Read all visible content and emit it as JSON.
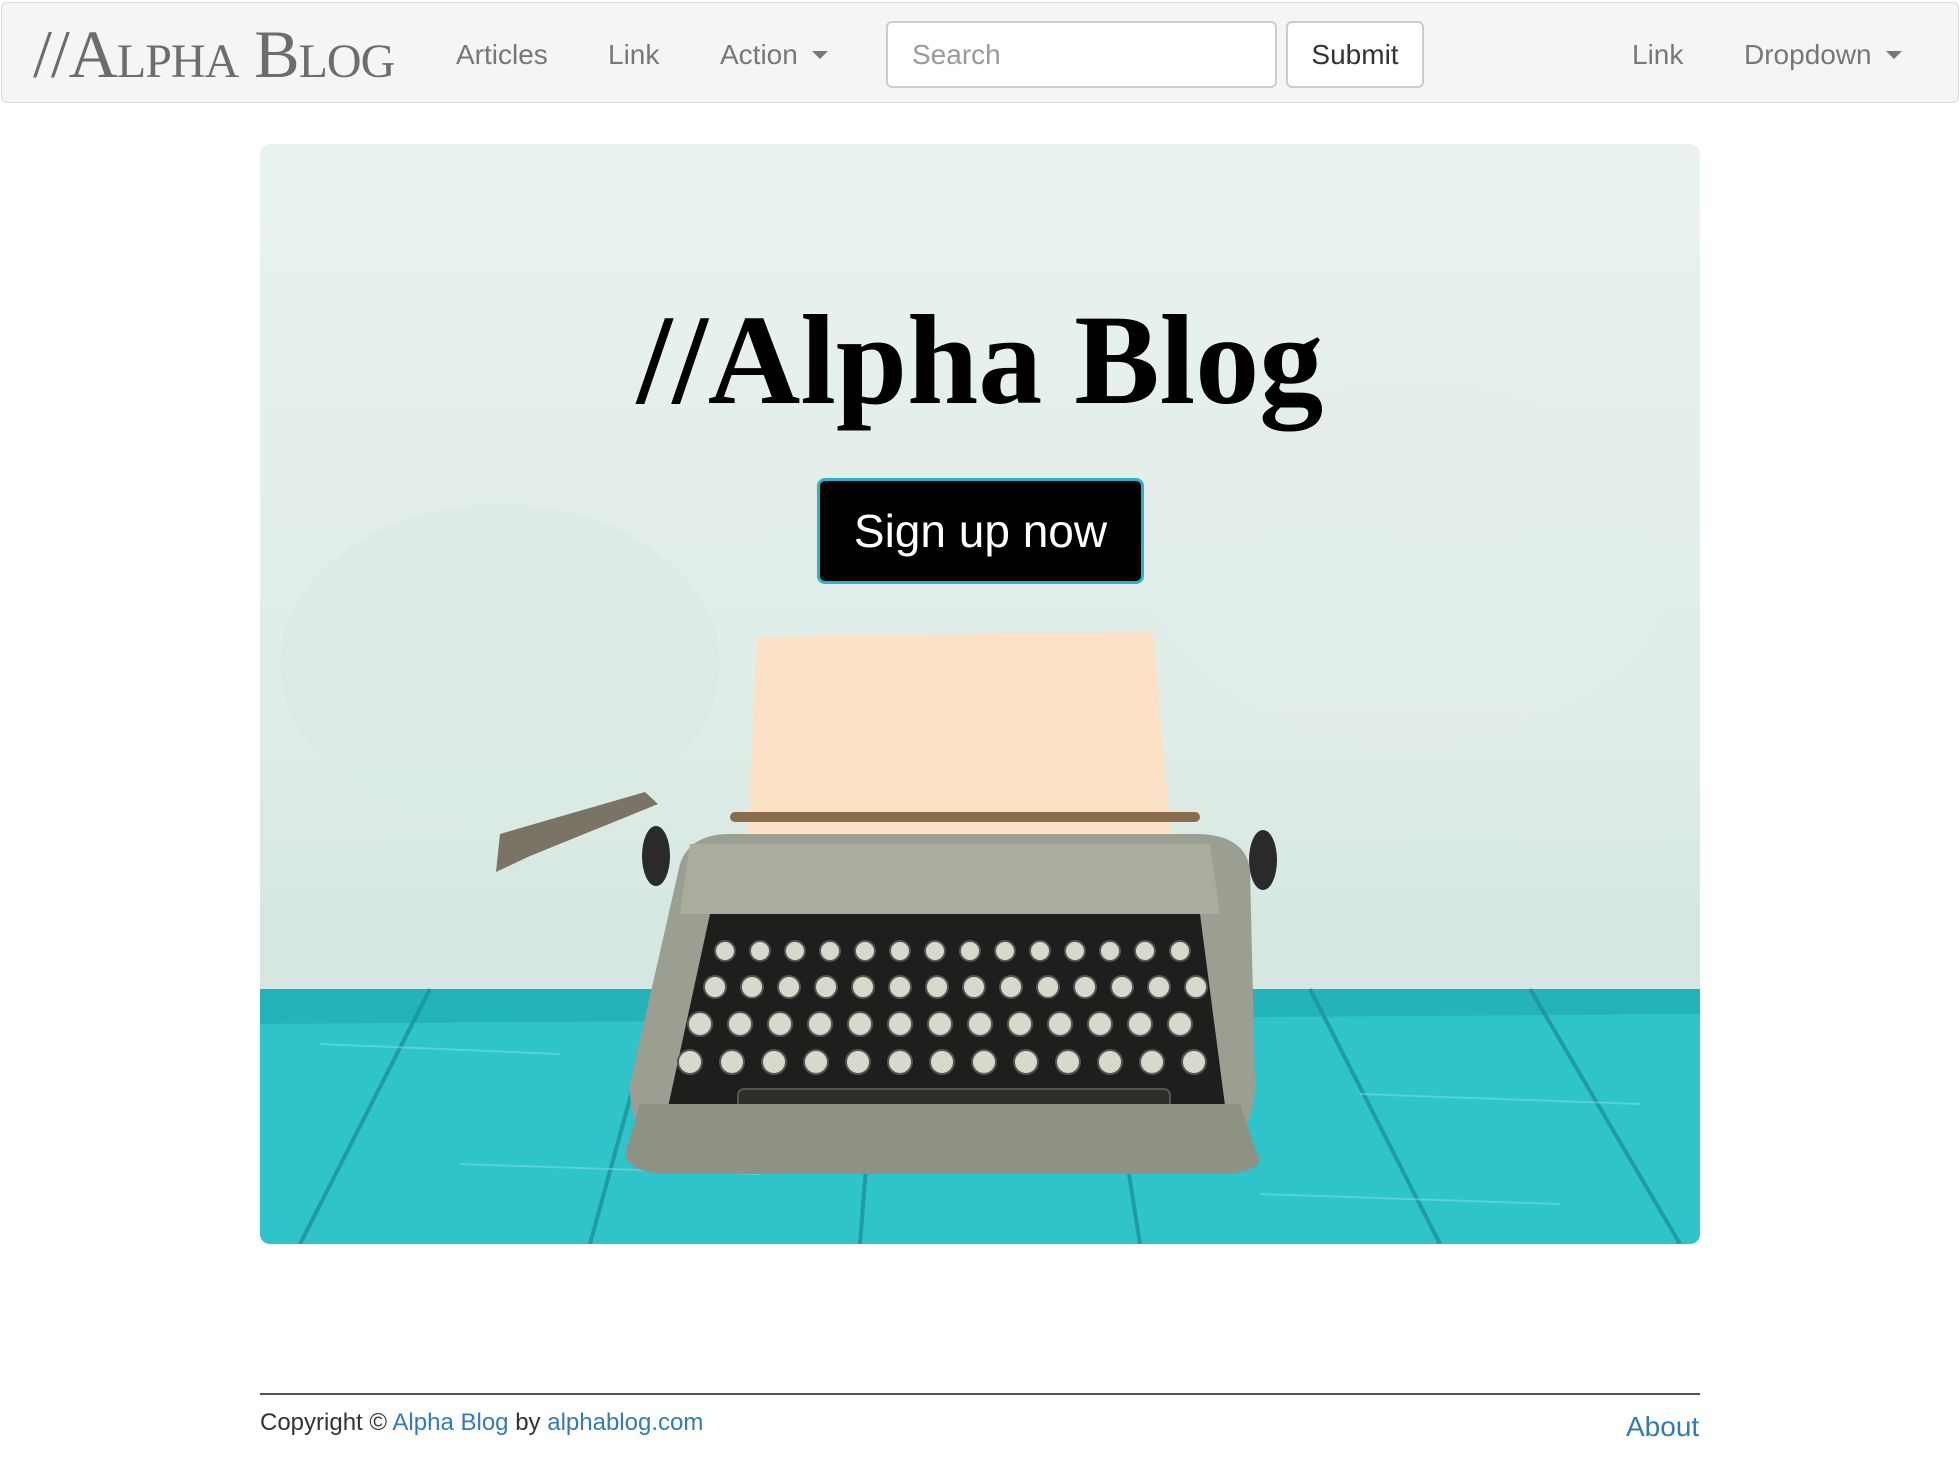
{
  "navbar": {
    "brand": "//Alpha Blog",
    "links_left": [
      {
        "label": "Articles"
      },
      {
        "label": "Link"
      },
      {
        "label": "Action"
      }
    ],
    "search": {
      "placeholder": "Search",
      "value": ""
    },
    "submit_label": "Submit",
    "links_right": [
      {
        "label": "Link"
      },
      {
        "label": "Dropdown"
      }
    ]
  },
  "hero": {
    "title": "//Alpha Blog",
    "cta_label": "Sign up now",
    "image": "vintage typewriter on turquoise wooden table"
  },
  "footer": {
    "copyright_prefix": "Copyright ©",
    "site_link": "Alpha Blog",
    "by_text": "by",
    "domain_link": "alphablog.com",
    "about_link": "About"
  },
  "colors": {
    "navbar_bg": "#f5f5f5",
    "link": "#337ab7",
    "cta_bg": "#000000",
    "cta_border": "#2bb3c9",
    "table": "#2ec4c9"
  }
}
